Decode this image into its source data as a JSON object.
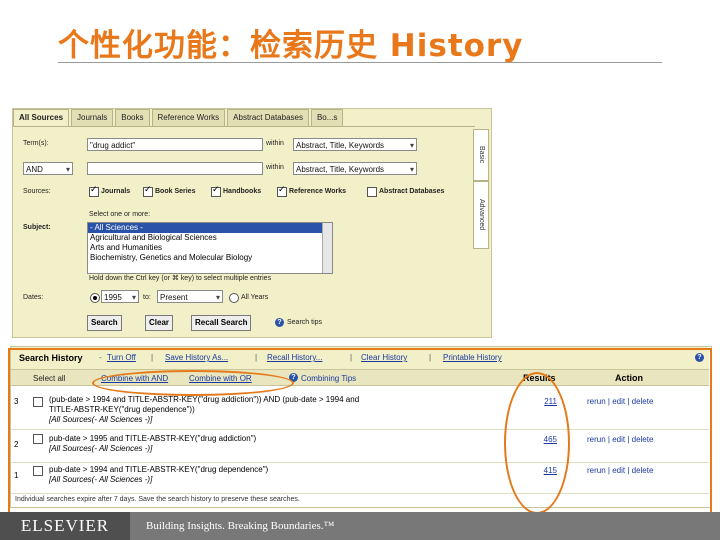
{
  "slide": {
    "title": "个性化功能：检索历史 History"
  },
  "search": {
    "tabs": [
      "All Sources",
      "Journals",
      "Books",
      "Reference Works",
      "Abstract Databases",
      "Bo...s"
    ],
    "term_label": "Term(s):",
    "term1_value": "\"drug addict\"",
    "within_label": "within",
    "within1_value": "Abstract, Title, Keywords",
    "operator_value": "AND",
    "within2_value": "Abstract, Title, Keywords",
    "sources_label": "Sources:",
    "sources": [
      "Journals",
      "Book Series",
      "Handbooks",
      "Reference Works",
      "Abstract Databases"
    ],
    "subject_label": "Subject:",
    "subject_hint": "Select one or more:",
    "subjects": [
      "- All Sciences -",
      "Agricultural and Biological Sciences",
      "Arts and Humanities",
      "Biochemistry, Genetics and Molecular Biology"
    ],
    "ctrl_hint": "Hold down the Ctrl key (or ⌘ key) to select multiple entries",
    "dates_label": "Dates:",
    "date_from": "1995",
    "to_label": "to:",
    "date_to": "Present",
    "all_years_label": "All Years",
    "search_button": "Search",
    "clear_button": "Clear",
    "recall_button": "Recall Search",
    "tips_label": "Search tips",
    "side_tab_basic": "Basic",
    "side_tab_advanced": "Advanced"
  },
  "history": {
    "title": "Search History",
    "links": [
      "Turn Off",
      "Save History As...",
      "Recall History...",
      "Clear History",
      "Printable History"
    ],
    "select_label": "Select all",
    "combine_and": "Combine with AND",
    "combine_or": "Combine with OR",
    "combining_tips": "Combining Tips",
    "results_header": "Results",
    "action_header": "Action",
    "rows": [
      {
        "num": "3",
        "query": "(pub-date > 1994 and TITLE-ABSTR-KEY(\"drug addiction\")) AND (pub-date > 1994 and\nTITLE-ABSTR-KEY(\"drug dependence\"))",
        "source": "[All Sources(- All Sciences -)]",
        "results": "211",
        "action": "rerun | edit | delete"
      },
      {
        "num": "2",
        "query": "pub-date > 1995 and TITLE-ABSTR-KEY(\"drug addiction\")",
        "source": "[All Sources(- All Sciences -)]",
        "results": "465",
        "action": "rerun | edit | delete"
      },
      {
        "num": "1",
        "query": "pub-date > 1994 and TITLE-ABSTR-KEY(\"drug dependence\")",
        "source": "[All Sources(- All Sciences -)]",
        "results": "415",
        "action": "rerun | edit | delete"
      }
    ],
    "footnote": "Individual searches expire after 7 days. Save the search history to preserve these searches."
  },
  "footer": {
    "logo": "ELSEVIER",
    "tagline": "Building Insights. Breaking Boundaries.™"
  },
  "colors": {
    "title": "#e8781a",
    "panel_bg": "#f2f0c8",
    "link": "#1a3aa0",
    "highlight": "#e57a1a",
    "footer": "#787878"
  }
}
